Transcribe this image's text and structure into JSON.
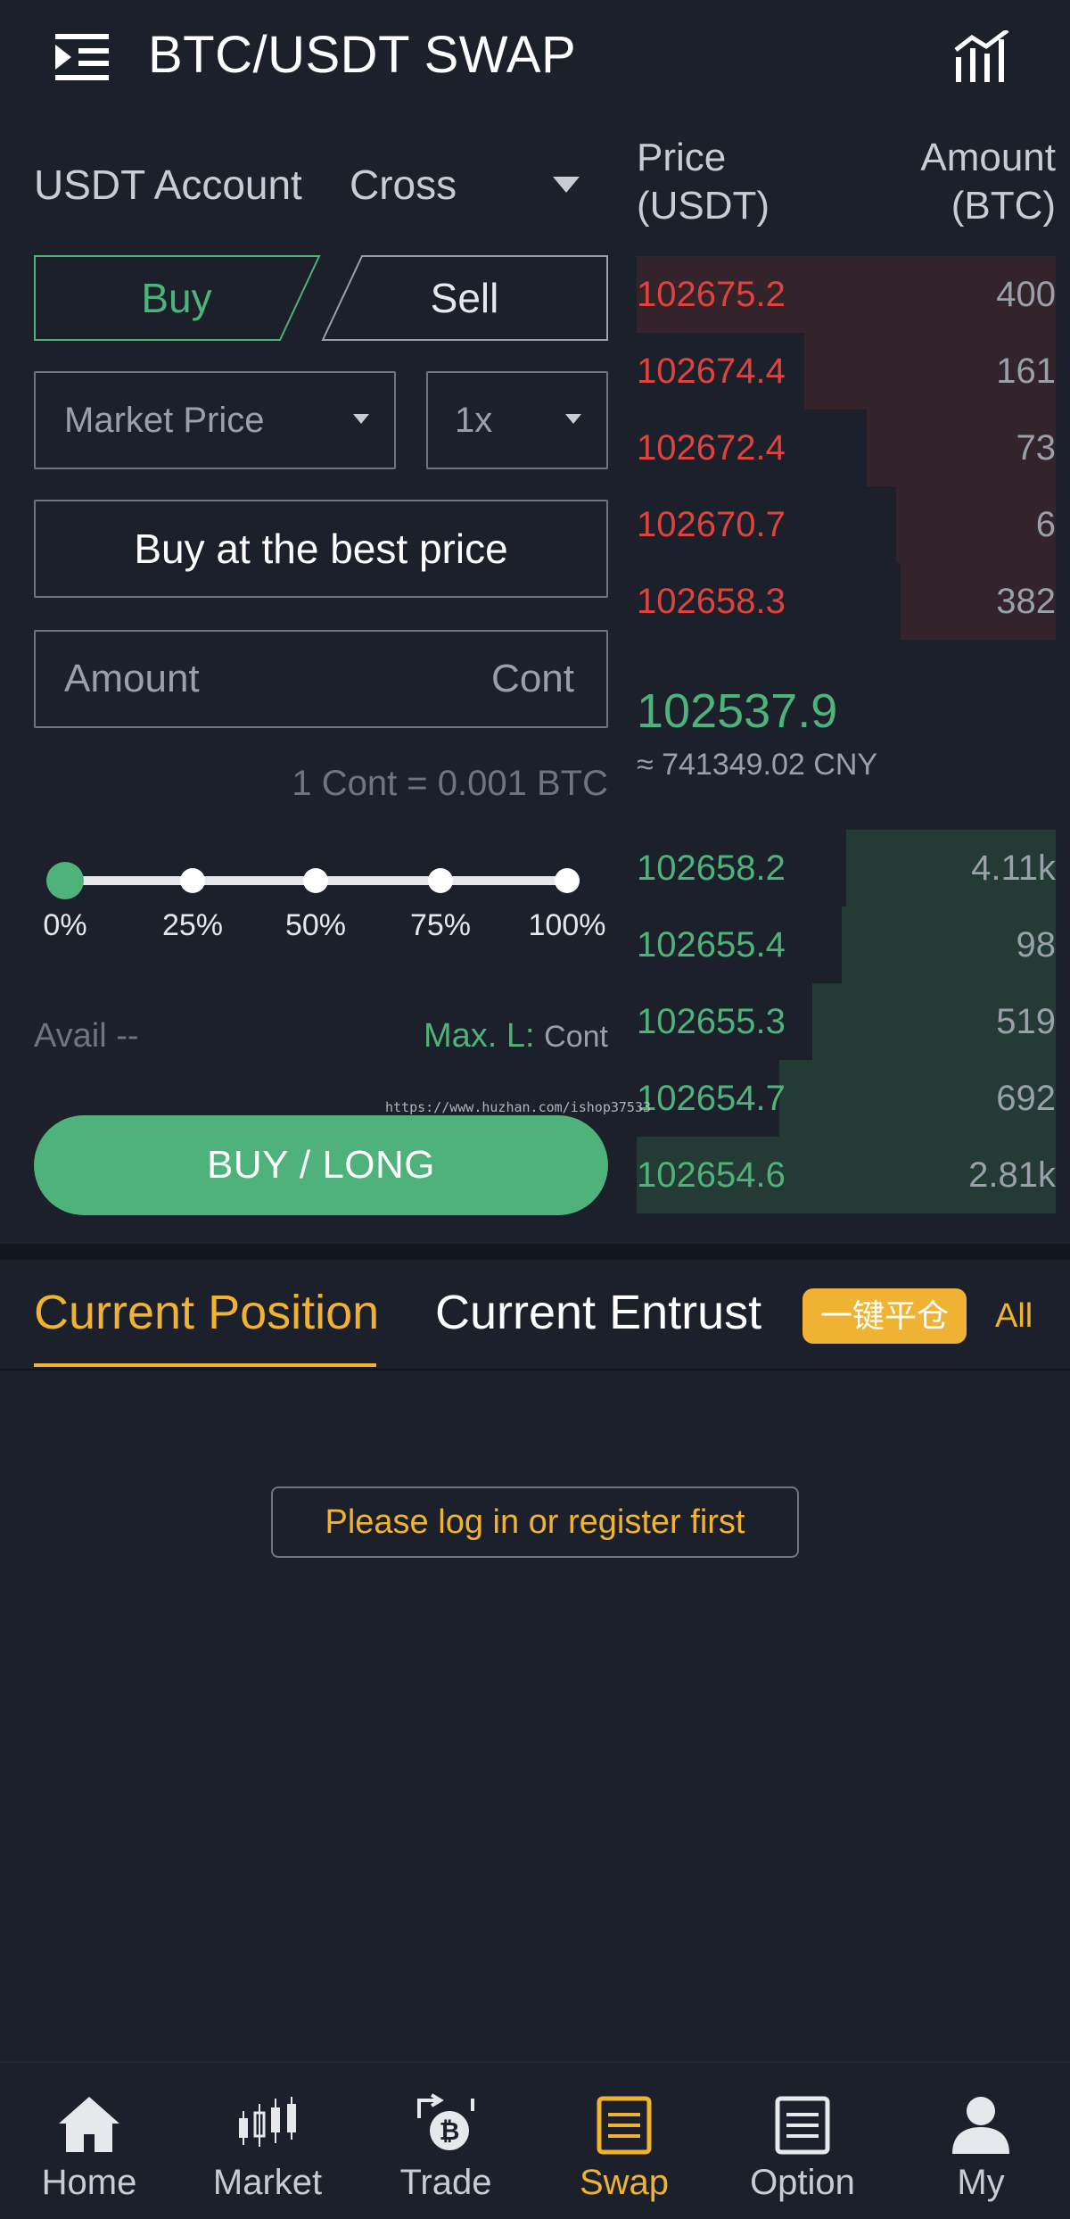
{
  "header": {
    "title": "BTC/USDT SWAP"
  },
  "trade_panel": {
    "account_label": "USDT Account",
    "margin_mode": "Cross",
    "buy_tab": "Buy",
    "sell_tab": "Sell",
    "order_type": "Market Price",
    "leverage": "1x",
    "best_price_button": "Buy at the best price",
    "amount_placeholder": "Amount",
    "amount_unit": "Cont",
    "cont_info": "1 Cont = 0.001 BTC",
    "slider": {
      "value_percent": 0,
      "labels": [
        "0%",
        "25%",
        "50%",
        "75%",
        "100%"
      ]
    },
    "avail_label": "Avail --",
    "maxl_label": "Max. L:",
    "maxl_unit": "Cont",
    "submit_button": "BUY / LONG"
  },
  "order_book": {
    "price_header_line1": "Price",
    "price_header_line2": "(USDT)",
    "amount_header_line1": "Amount",
    "amount_header_line2": "(BTC)",
    "asks": [
      {
        "price": "102675.2",
        "amount": "400",
        "depth": 1.0
      },
      {
        "price": "102674.4",
        "amount": "161",
        "depth": 0.6
      },
      {
        "price": "102672.4",
        "amount": "73",
        "depth": 0.45
      },
      {
        "price": "102670.7",
        "amount": "6",
        "depth": 0.38
      },
      {
        "price": "102658.3",
        "amount": "382",
        "depth": 0.37
      }
    ],
    "last_price": "102537.9",
    "last_price_cny": "≈ 741349.02 CNY",
    "bids": [
      {
        "price": "102658.2",
        "amount": "4.11k",
        "depth": 0.5
      },
      {
        "price": "102655.4",
        "amount": "98",
        "depth": 0.51
      },
      {
        "price": "102655.3",
        "amount": "519",
        "depth": 0.58
      },
      {
        "price": "102654.7",
        "amount": "692",
        "depth": 0.66
      },
      {
        "price": "102654.6",
        "amount": "2.81k",
        "depth": 1.0
      }
    ]
  },
  "watermark": "https://www.huzhan.com/ishop37533",
  "positions": {
    "tab_current_position": "Current Position",
    "tab_current_entrust": "Current Entrust",
    "close_all_button": "一键平仓",
    "all_link": "All",
    "login_prompt": "Please log in or register first"
  },
  "bottom_nav": [
    {
      "label": "Home",
      "icon": "home-icon"
    },
    {
      "label": "Market",
      "icon": "candlestick-icon"
    },
    {
      "label": "Trade",
      "icon": "bitcoin-exchange-icon"
    },
    {
      "label": "Swap",
      "icon": "swap-document-icon",
      "active": true
    },
    {
      "label": "Option",
      "icon": "option-document-icon"
    },
    {
      "label": "My",
      "icon": "user-icon"
    }
  ],
  "colors": {
    "background": "#1b202a",
    "buy_green": "#4fb27a",
    "sell_red": "#e0433f",
    "accent_orange": "#f0b233"
  }
}
